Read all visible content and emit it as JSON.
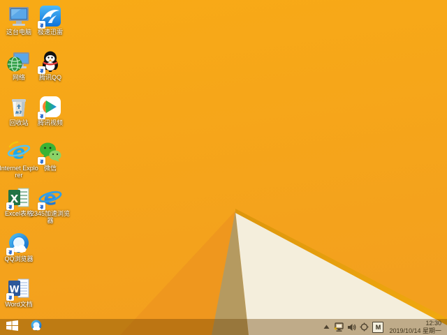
{
  "wallpaper": {
    "base_orange": "#F7A51B",
    "deep_orange": "#EF971E",
    "khaki_facet": "#B59A60",
    "cream_facet": "#F4EEDC",
    "amber_edge": "#E9A00E"
  },
  "desktop": {
    "icons": [
      {
        "label": "这台电脑",
        "name": "this-pc",
        "has_shortcut_arrow": false
      },
      {
        "label": "网络",
        "name": "network",
        "has_shortcut_arrow": false
      },
      {
        "label": "回收站",
        "name": "recycle-bin",
        "has_shortcut_arrow": false
      },
      {
        "label": "Internet Explorer",
        "name": "internet-explorer",
        "has_shortcut_arrow": false
      },
      {
        "label": "Excel表格",
        "name": "excel",
        "has_shortcut_arrow": true
      },
      {
        "label": "QQ浏览器",
        "name": "qq-browser",
        "has_shortcut_arrow": true
      },
      {
        "label": "Word文档",
        "name": "word",
        "has_shortcut_arrow": true
      },
      {
        "label": "极速迅雷",
        "name": "xunlei",
        "has_shortcut_arrow": true
      },
      {
        "label": "腾讯QQ",
        "name": "tencent-qq",
        "has_shortcut_arrow": true
      },
      {
        "label": "腾讯视频",
        "name": "tencent-video",
        "has_shortcut_arrow": true
      },
      {
        "label": "微信",
        "name": "wechat",
        "has_shortcut_arrow": true
      },
      {
        "label": "2345加速浏览器",
        "name": "browser-2345",
        "has_shortcut_arrow": true
      }
    ]
  },
  "taskbar": {
    "pinned": [
      {
        "name": "qq-browser"
      }
    ],
    "tray": {
      "input_indicator": "M"
    },
    "clock": {
      "time": "12:30",
      "date": "2019/10/14 星期一"
    }
  }
}
